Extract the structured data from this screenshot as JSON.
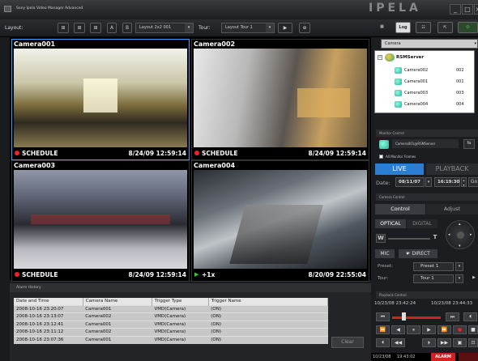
{
  "app": {
    "title": "Sony Ipela Video Manager Advanced",
    "logo": "IPELA",
    "minimize": "_",
    "maximize": "□"
  },
  "toolbar": {
    "layout_label": "Layout:",
    "layout_value": "Layout 2x2 001",
    "tour_label": "Tour:",
    "tour_value": "Layout Tour 1",
    "log_label": "Log",
    "icon_a": "A",
    "icon_b": "B",
    "dropdown_arrow": "▾",
    "play_glyph": "▶"
  },
  "cameras": [
    {
      "name": "Camera001",
      "status": "SCHEDULE",
      "timestamp": "8/24/09 12:59:14",
      "mode": "record",
      "selected": true
    },
    {
      "name": "Camera002",
      "status": "SCHEDULE",
      "timestamp": "8/24/09 12:59:14",
      "mode": "record",
      "selected": false
    },
    {
      "name": "Camera003",
      "status": "SCHEDULE",
      "timestamp": "8/24/09 12:59:14",
      "mode": "record",
      "selected": false
    },
    {
      "name": "Camera004",
      "status": "+1x",
      "timestamp": "8/20/09 22:55:04",
      "mode": "playback",
      "selected": false
    }
  ],
  "alarm": {
    "title": "Alarm History",
    "columns": [
      "Date and Time",
      "Camera Name",
      "Trigger Type",
      "Trigger Name"
    ],
    "rows": [
      [
        "2008-10-16 23:20:07",
        "Camera001",
        "VMD(Camera)",
        "(ON)"
      ],
      [
        "2008-10-16 23:13:07",
        "Camera002",
        "VMD(Camera)",
        "(ON)"
      ],
      [
        "2008-10-16 23:12:41",
        "Camera001",
        "VMD(Camera)",
        "(ON)"
      ],
      [
        "2008-10-16 23:11:12",
        "Camera002",
        "VMD(Camera)",
        "(ON)"
      ],
      [
        "2008-10-16 23:07:36",
        "Camera001",
        "VMD(Camera)",
        "(ON)"
      ]
    ],
    "clear_label": "Clear"
  },
  "tree": {
    "filter": "Camera",
    "server": "RSMServer",
    "items": [
      {
        "name": "Camera002",
        "id": "002"
      },
      {
        "name": "Camera001",
        "id": "001"
      },
      {
        "name": "Camera003",
        "id": "003"
      },
      {
        "name": "Camera004",
        "id": "004"
      }
    ]
  },
  "monitor": {
    "title": "Monitor Control",
    "camera": "Camera001@RSMServer",
    "all_monitor": "All Monitor Frames",
    "live": "LIVE",
    "playback": "PLAYBACK",
    "date_label": "Date:",
    "date_value": "08/11/07",
    "time_value": "16:19:30",
    "go": "Go"
  },
  "camera_control": {
    "title": "Camera Control",
    "tab_control": "Control",
    "tab_adjust": "Adjust",
    "optical": "OPTICAL",
    "digital": "DIGITAL",
    "wide": "W",
    "tele": "T",
    "mic": "MIC",
    "direct": "DIRECT",
    "preset_label": "Preset:",
    "preset_value": "Preset 1",
    "tour_label": "Tour:",
    "tour_value": "Tour 1"
  },
  "playback_control": {
    "title": "Playback Control",
    "start": "10/23/08 23:42:24",
    "end": "10/23/08 23:44:33",
    "position": 0.2
  },
  "status_bar": {
    "date": "10/23/08",
    "time": "19:43:02",
    "alarm": "ALARM"
  },
  "colors": {
    "accent": "#2ea0ff",
    "live": "#2a7fd4",
    "record": "#e22222",
    "alarm": "#d42020"
  }
}
